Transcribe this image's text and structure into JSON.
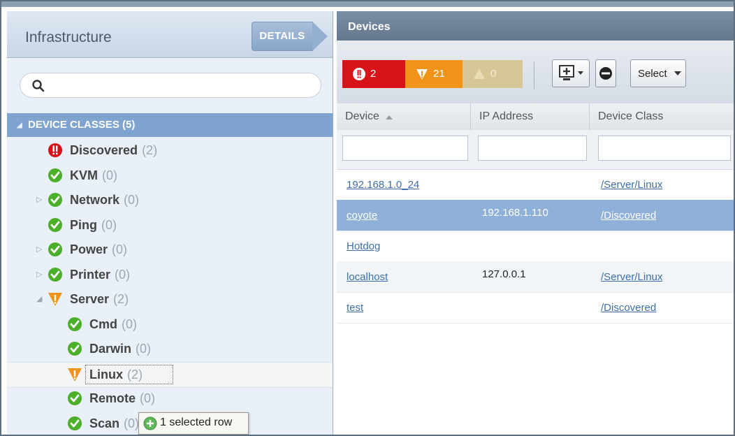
{
  "colors": {
    "critical": "#d71218",
    "error": "#ef9418",
    "warning": "#d8c796",
    "success": "#4caf2a",
    "selection": "#8fb0d8",
    "header": "#7ea4cf",
    "panel_title": "#6e8299"
  },
  "left_panel": {
    "title": "Infrastructure",
    "details_label": "DETAILS",
    "search_placeholder": "",
    "tree_header": "DEVICE CLASSES (5)",
    "nodes": [
      {
        "label": "Discovered",
        "count": "(2)",
        "status": "critical",
        "expander": ""
      },
      {
        "label": "KVM",
        "count": "(0)",
        "status": "ok",
        "expander": ""
      },
      {
        "label": "Network",
        "count": "(0)",
        "status": "ok",
        "expander": "▷"
      },
      {
        "label": "Ping",
        "count": "(0)",
        "status": "ok",
        "expander": ""
      },
      {
        "label": "Power",
        "count": "(0)",
        "status": "ok",
        "expander": "▷"
      },
      {
        "label": "Printer",
        "count": "(0)",
        "status": "ok",
        "expander": "▷"
      },
      {
        "label": "Server",
        "count": "(2)",
        "status": "warning",
        "expander": "◢"
      },
      {
        "label": "Cmd",
        "count": "(0)",
        "status": "ok",
        "expander": ""
      },
      {
        "label": "Darwin",
        "count": "(0)",
        "status": "ok",
        "expander": ""
      },
      {
        "label": "Linux",
        "count": "(2)",
        "status": "warning",
        "expander": ""
      },
      {
        "label": "Remote",
        "count": "(0)",
        "status": "ok",
        "expander": ""
      },
      {
        "label": "Scan",
        "count": "(0)",
        "status": "ok",
        "expander": ""
      }
    ],
    "tooltip": "1 selected row"
  },
  "right_panel": {
    "title": "Devices",
    "severity": {
      "critical": "2",
      "error": "21",
      "warning": "0"
    },
    "select_label": "Select",
    "columns": [
      "Device",
      "IP Address",
      "Device Class"
    ],
    "rows": [
      {
        "device": "192.168.1.0_24",
        "ip": "",
        "device_class": "/Server/Linux"
      },
      {
        "device": "coyote",
        "ip": "192.168.1.110",
        "device_class": "/Discovered",
        "selected": true
      },
      {
        "device": "Hotdog",
        "ip": "",
        "device_class": ""
      },
      {
        "device": "localhost",
        "ip": "127.0.0.1",
        "device_class": "/Server/Linux"
      },
      {
        "device": "test",
        "ip": "",
        "device_class": "/Discovered"
      }
    ]
  }
}
